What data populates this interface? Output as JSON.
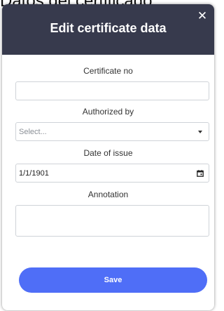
{
  "background_title": "Datos del certificado",
  "modal": {
    "title": "Edit certificate data",
    "close_symbol": "✕"
  },
  "fields": {
    "certificate_no": {
      "label": "Certificate no",
      "value": ""
    },
    "authorized_by": {
      "label": "Authorized by",
      "placeholder": "Select..."
    },
    "date_of_issue": {
      "label": "Date of issue",
      "value": "1/1/1901"
    },
    "annotation": {
      "label": "Annotation",
      "value": ""
    }
  },
  "actions": {
    "save_label": "Save"
  },
  "colors": {
    "header_bg": "#373a4d",
    "save_button": "#4f6ef7",
    "input_border": "#cfd3d8"
  },
  "icons": {
    "close": "close-icon",
    "dropdown": "chevron-down-icon",
    "date": "calendar-icon"
  }
}
